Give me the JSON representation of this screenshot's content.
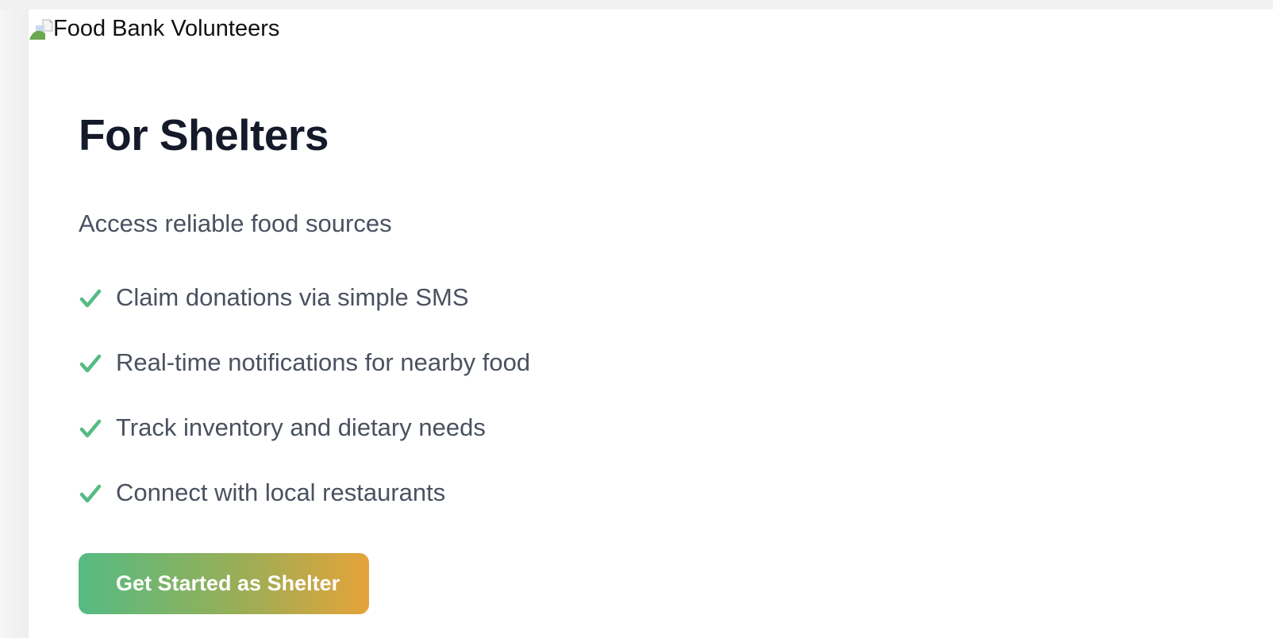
{
  "header": {
    "logo_alt": "Food Bank Volunteers"
  },
  "main": {
    "title": "For Shelters",
    "subtitle": "Access reliable food sources",
    "features": [
      "Claim donations via simple SMS",
      "Real-time notifications for nearby food",
      "Track inventory and dietary needs",
      "Connect with local restaurants"
    ],
    "cta_label": "Get Started as Shelter"
  },
  "colors": {
    "title": "#141a2a",
    "body_text": "#4a5160",
    "check": "#55bb83",
    "cta_gradient_start": "#55bb83",
    "cta_gradient_end": "#e6a33a"
  },
  "icons": {
    "logo": "broken-image-icon",
    "feature_bullet": "check-icon"
  }
}
